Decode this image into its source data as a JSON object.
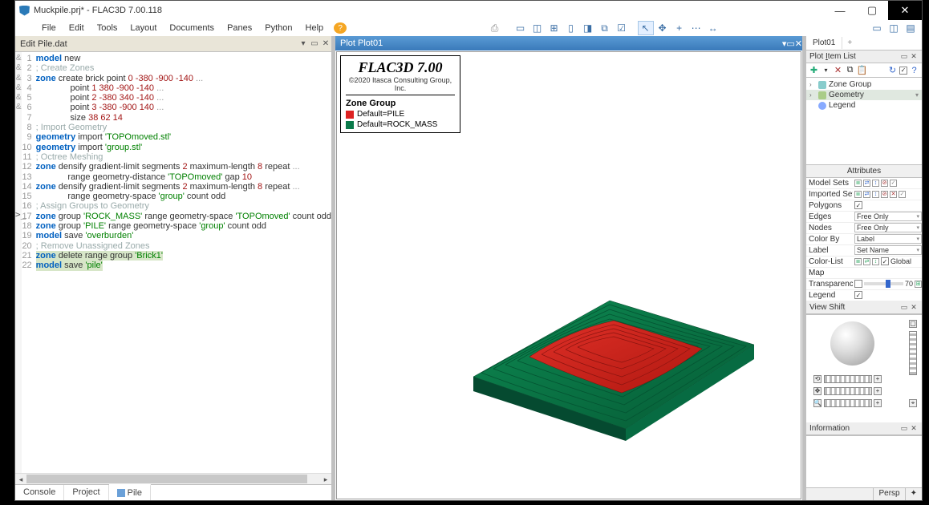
{
  "title": "Muckpile.prj* - FLAC3D 7.00.118",
  "menus": [
    "File",
    "Edit",
    "Tools",
    "Layout",
    "Documents",
    "Panes",
    "Python",
    "Help"
  ],
  "editor": {
    "tab": "Edit Pile.dat",
    "breaks": [
      "",
      "",
      "",
      "&",
      "&",
      "&",
      "&",
      "",
      "",
      "",
      "",
      "",
      "&",
      "",
      "&",
      "",
      "",
      "",
      "",
      "",
      "",
      ""
    ],
    "lines": [
      1,
      2,
      3,
      4,
      5,
      6,
      7,
      8,
      9,
      10,
      11,
      12,
      13,
      14,
      15,
      16,
      17,
      18,
      19,
      20,
      21,
      22
    ],
    "bottom_tabs": [
      "Console",
      "Project",
      "Pile"
    ]
  },
  "code_tokens": [
    [
      [
        "kw",
        "model"
      ],
      [
        "",
        " new"
      ]
    ],
    [
      [
        "com",
        "; Create Zones"
      ]
    ],
    [
      [
        "kw",
        "zone"
      ],
      [
        "",
        " create brick point "
      ],
      [
        "num",
        "0 -380 -900 -140"
      ],
      [
        "",
        " "
      ],
      [
        "cont",
        "..."
      ]
    ],
    [
      [
        "",
        ""
      ],
      [
        "",
        "              point "
      ],
      [
        "num",
        "1 380 -900 -140"
      ],
      [
        "",
        " "
      ],
      [
        "cont",
        "..."
      ]
    ],
    [
      [
        "",
        ""
      ],
      [
        "",
        "              point "
      ],
      [
        "num",
        "2 -380 340 -140"
      ],
      [
        "",
        " "
      ],
      [
        "cont",
        "..."
      ]
    ],
    [
      [
        "",
        ""
      ],
      [
        "",
        "              point "
      ],
      [
        "num",
        "3 -380 -900 140"
      ],
      [
        "",
        " "
      ],
      [
        "cont",
        "..."
      ]
    ],
    [
      [
        "",
        ""
      ],
      [
        "",
        "              size "
      ],
      [
        "num",
        "38 62 14"
      ]
    ],
    [
      [
        "com",
        "; Import Geometry"
      ]
    ],
    [
      [
        "kw",
        "geometry"
      ],
      [
        "",
        " import "
      ],
      [
        "str",
        "'TOPOmoved.stl'"
      ]
    ],
    [
      [
        "kw",
        "geometry"
      ],
      [
        "",
        " import "
      ],
      [
        "str",
        "'group.stl'"
      ]
    ],
    [
      [
        "com",
        "; Octree Meshing"
      ]
    ],
    [
      [
        "kw",
        "zone"
      ],
      [
        "",
        " densify gradient-limit segments "
      ],
      [
        "num",
        "2"
      ],
      [
        "",
        " maximum-length "
      ],
      [
        "num",
        "8"
      ],
      [
        "",
        " repeat "
      ],
      [
        "cont",
        "..."
      ]
    ],
    [
      [
        "",
        ""
      ],
      [
        "",
        "             range geometry-distance "
      ],
      [
        "str",
        "'TOPOmoved'"
      ],
      [
        "",
        " gap "
      ],
      [
        "num",
        "10"
      ]
    ],
    [
      [
        "kw",
        "zone"
      ],
      [
        "",
        " densify gradient-limit segments "
      ],
      [
        "num",
        "2"
      ],
      [
        "",
        " maximum-length "
      ],
      [
        "num",
        "8"
      ],
      [
        "",
        " repeat "
      ],
      [
        "cont",
        "..."
      ]
    ],
    [
      [
        "",
        ""
      ],
      [
        "",
        "             range geometry-space "
      ],
      [
        "str",
        "'group'"
      ],
      [
        "",
        " count odd"
      ]
    ],
    [
      [
        "com",
        "; Assign Groups to Geometry"
      ]
    ],
    [
      [
        "kw",
        "zone"
      ],
      [
        "",
        " group "
      ],
      [
        "str",
        "'ROCK_MASS'"
      ],
      [
        "",
        " range geometry-space "
      ],
      [
        "str",
        "'TOPOmoved'"
      ],
      [
        "",
        " count odd"
      ]
    ],
    [
      [
        "kw",
        "zone"
      ],
      [
        "",
        " group "
      ],
      [
        "str",
        "'PILE'"
      ],
      [
        "",
        " range geometry-space "
      ],
      [
        "str",
        "'group'"
      ],
      [
        "",
        " count odd"
      ]
    ],
    [
      [
        "kw",
        "model"
      ],
      [
        "",
        " save "
      ],
      [
        "str",
        "'overburden'"
      ]
    ],
    [
      [
        "com",
        "; Remove Unassigned Zones"
      ]
    ],
    [
      [
        "kw",
        "zone"
      ],
      [
        "",
        " delete range group "
      ],
      [
        "str",
        "'Brick1'"
      ]
    ],
    [
      [
        "kw",
        "model"
      ],
      [
        "",
        " save "
      ],
      [
        "str",
        "'pile'"
      ]
    ]
  ],
  "hl_lines": [
    21,
    22
  ],
  "plot": {
    "tab": "Plot Plot01",
    "legend_title": "FLAC3D 7.00",
    "copyright": "©2020 Itasca Consulting Group, Inc.",
    "group": "Zone Group",
    "items": [
      {
        "color": "#d22",
        "label": "Default=PILE"
      },
      {
        "color": "#0a7a4a",
        "label": "Default=ROCK_MASS"
      }
    ]
  },
  "right": {
    "tab": "Plot01",
    "list_head": "Plot Item List",
    "tree": [
      "Zone Group",
      "Geometry",
      "Legend"
    ],
    "attr_head": "Attributes",
    "attrs": [
      {
        "k": "Model Sets",
        "type": "btns"
      },
      {
        "k": "Imported Sets",
        "type": "btns2"
      },
      {
        "k": "Polygons",
        "type": "chk",
        "v": true
      },
      {
        "k": "Edges",
        "type": "sel",
        "v": "Free Only"
      },
      {
        "k": "Nodes",
        "type": "sel",
        "v": "Free Only"
      },
      {
        "k": "Color By",
        "type": "sel",
        "v": "Label"
      },
      {
        "k": "Label",
        "type": "sel",
        "v": "Set Name"
      },
      {
        "k": "Color-List",
        "type": "clist",
        "v": "Global"
      },
      {
        "k": "Map",
        "type": "blank"
      },
      {
        "k": "Transparency",
        "type": "slider",
        "v": "70"
      },
      {
        "k": "Legend",
        "type": "chk",
        "v": true
      }
    ],
    "viewshift": "View Shift",
    "information": "Information"
  },
  "status": {
    "view": "Persp"
  }
}
